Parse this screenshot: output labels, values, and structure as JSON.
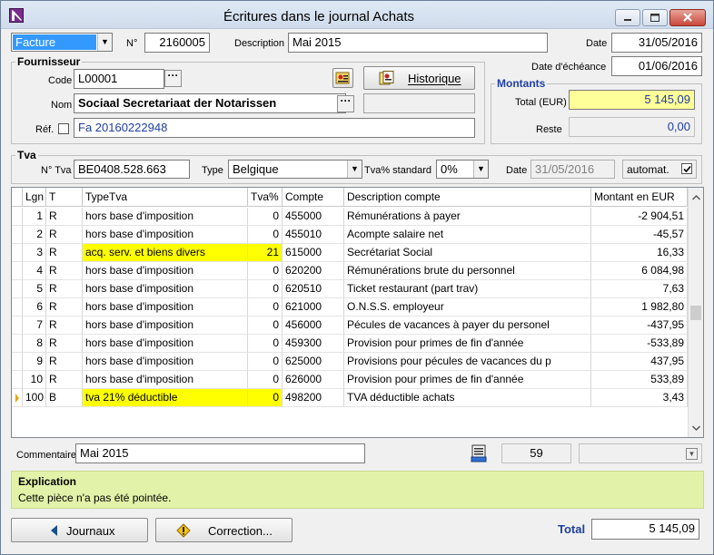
{
  "window": {
    "title": "Écritures dans le journal Achats"
  },
  "header": {
    "doc_type": "Facture",
    "number_label": "N°",
    "number": "2160005",
    "description_label": "Description",
    "description": "Mai 2015",
    "date_label": "Date",
    "date": "31/05/2016",
    "due_date_label": "Date d'échéance",
    "due_date": "01/06/2016"
  },
  "supplier": {
    "group_title": "Fournisseur",
    "code_label": "Code",
    "code": "L00001",
    "name_label": "Nom",
    "name": "Sociaal Secretariaat der Notarissen",
    "ref_label": "Réf.",
    "ref": "Fa 20160222948",
    "history_button": "Historique"
  },
  "amounts": {
    "group_title": "Montants",
    "total_label": "Total (EUR)",
    "total": "5 145,09",
    "rest_label": "Reste",
    "rest": "0,00"
  },
  "tva": {
    "group_title": "Tva",
    "number_label": "N° Tva",
    "number": "BE0408.528.663",
    "type_label": "Type",
    "type": "Belgique",
    "std_label": "Tva% standard",
    "std": "0%",
    "date_label": "Date",
    "date": "31/05/2016",
    "auto_label": "automat.",
    "auto_checked": true
  },
  "grid": {
    "columns": [
      "Lgn",
      "T",
      "TypeTva",
      "Tva%",
      "Compte",
      "Description compte",
      "Montant en EUR"
    ],
    "rows": [
      {
        "lgn": "1",
        "t": "R",
        "typetva": "hors base d'imposition",
        "tva": "0",
        "compte": "455000",
        "desc": "Rémunérations à payer",
        "montant": "-2 904,51",
        "hl": false
      },
      {
        "lgn": "2",
        "t": "R",
        "typetva": "hors base d'imposition",
        "tva": "0",
        "compte": "455010",
        "desc": "Acompte salaire net",
        "montant": "-45,57",
        "hl": false
      },
      {
        "lgn": "3",
        "t": "R",
        "typetva": "acq. serv. et biens divers",
        "tva": "21",
        "compte": "615000",
        "desc": "Secrétariat Social",
        "montant": "16,33",
        "hl": true
      },
      {
        "lgn": "4",
        "t": "R",
        "typetva": "hors base d'imposition",
        "tva": "0",
        "compte": "620200",
        "desc": "Rémunérations brute du personnel",
        "montant": "6 084,98",
        "hl": false
      },
      {
        "lgn": "5",
        "t": "R",
        "typetva": "hors base d'imposition",
        "tva": "0",
        "compte": "620510",
        "desc": "Ticket restaurant (part trav)",
        "montant": "7,63",
        "hl": false
      },
      {
        "lgn": "6",
        "t": "R",
        "typetva": "hors base d'imposition",
        "tva": "0",
        "compte": "621000",
        "desc": "O.N.S.S. employeur",
        "montant": "1 982,80",
        "hl": false
      },
      {
        "lgn": "7",
        "t": "R",
        "typetva": "hors base d'imposition",
        "tva": "0",
        "compte": "456000",
        "desc": "Pécules de vacances à payer du personel",
        "montant": "-437,95",
        "hl": false
      },
      {
        "lgn": "8",
        "t": "R",
        "typetva": "hors base d'imposition",
        "tva": "0",
        "compte": "459300",
        "desc": "Provision pour primes de fin d'année",
        "montant": "-533,89",
        "hl": false
      },
      {
        "lgn": "9",
        "t": "R",
        "typetva": "hors base d'imposition",
        "tva": "0",
        "compte": "625000",
        "desc": "Provisions pour pécules de vacances du p",
        "montant": "437,95",
        "hl": false
      },
      {
        "lgn": "10",
        "t": "R",
        "typetva": "hors base d'imposition",
        "tva": "0",
        "compte": "626000",
        "desc": "Provision pour primes de fin d'année",
        "montant": "533,89",
        "hl": false
      },
      {
        "lgn": "100",
        "t": "B",
        "typetva": "tva 21% déductible",
        "tva": "0",
        "compte": "498200",
        "desc": "TVA déductible achats",
        "montant": "3,43",
        "hl": true,
        "current": true
      }
    ]
  },
  "comment": {
    "label": "Commentaire",
    "value": "Mai 2015",
    "count": "59"
  },
  "explanation": {
    "title": "Explication",
    "text": "Cette pièce n'a pas été pointée."
  },
  "footer": {
    "journals_button": "Journaux",
    "correction_button": "Correction...",
    "total_label": "Total",
    "total": "5 145,09"
  },
  "colors": {
    "highlight": "#ffff00",
    "total_field": "#ffff99",
    "explanation_bg": "#e2f2a8",
    "link_blue": "#1f3fa0"
  }
}
